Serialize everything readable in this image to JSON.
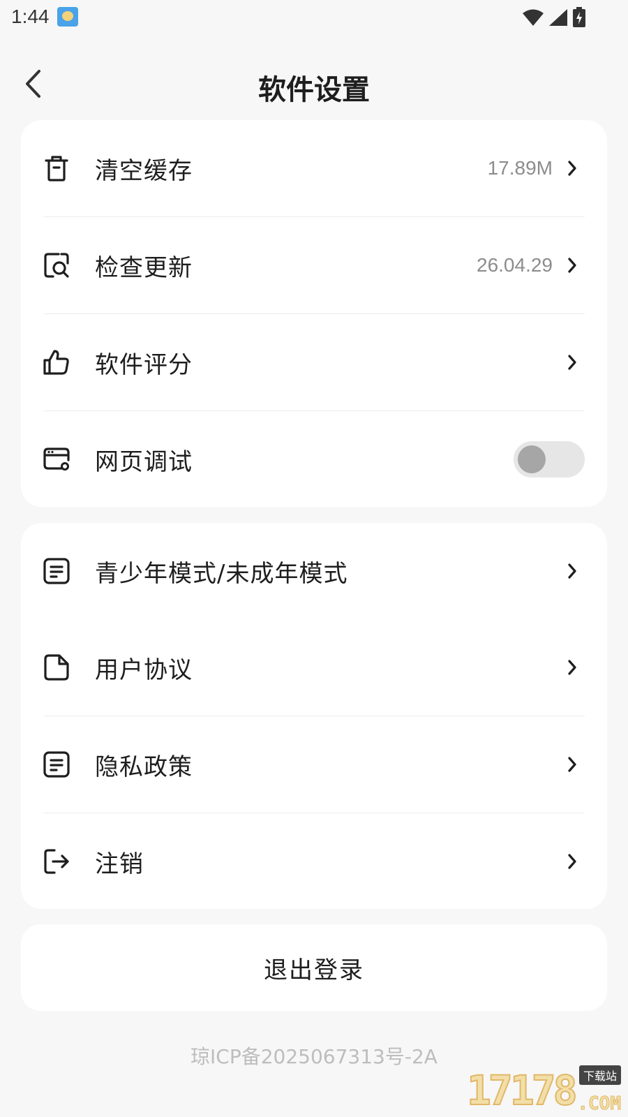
{
  "status_bar": {
    "time": "1:44"
  },
  "header": {
    "title": "软件设置"
  },
  "settings_group_1": {
    "items": [
      {
        "icon": "trash-icon",
        "label": "清空缓存",
        "value": "17.89M"
      },
      {
        "icon": "search-document-icon",
        "label": "检查更新",
        "value": "26.04.29"
      },
      {
        "icon": "thumbs-up-icon",
        "label": "软件评分",
        "value": ""
      },
      {
        "icon": "browser-icon",
        "label": "网页调试",
        "toggle": false
      }
    ]
  },
  "settings_group_2": {
    "items": [
      {
        "icon": "note-icon",
        "label": "青少年模式/未成年模式"
      },
      {
        "icon": "document-icon",
        "label": "用户协议"
      },
      {
        "icon": "note-icon",
        "label": "隐私政策"
      },
      {
        "icon": "logout-icon",
        "label": "注销"
      }
    ]
  },
  "logout": {
    "label": "退出登录"
  },
  "footer": {
    "icp": "琼ICP备2025067313号-2A"
  },
  "watermark": {
    "number": "17178",
    "tag": "下载站",
    "suffix": ".COM"
  },
  "colors": {
    "background": "#f7f7f7",
    "card": "#ffffff",
    "text": "#1e1e1e",
    "secondary_text": "#8c8c8c",
    "toggle_off": "#e6e6e6"
  }
}
